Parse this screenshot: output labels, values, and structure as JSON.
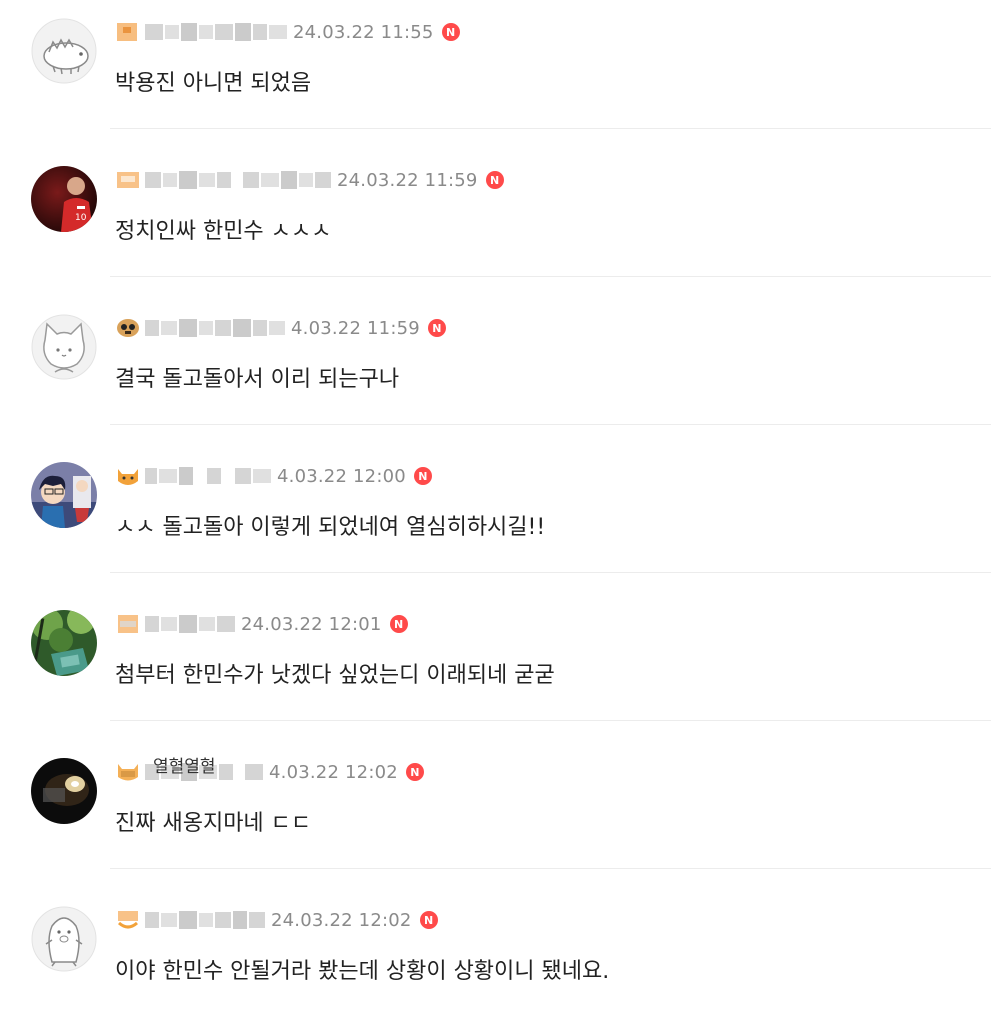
{
  "comments": [
    {
      "timestamp": "24.03.22 11:55",
      "text": "박용진 아니면 되었음",
      "badge": "N",
      "avatar": "dragon-avatar",
      "level_icon": "orange-square-icon"
    },
    {
      "timestamp": "24.03.22 11:59",
      "text": "정치인싸 한민수 ㅅㅅㅅ",
      "badge": "N",
      "avatar": "soccer-player-avatar",
      "level_icon": "orange-square-icon"
    },
    {
      "timestamp": "4.03.22 11:59",
      "text": "결국 돌고돌아서 이리 되는구나",
      "badge": "N",
      "avatar": "cat-avatar",
      "level_icon": "face-icon"
    },
    {
      "timestamp": "4.03.22 12:00",
      "text": "ㅅㅅ 돌고돌아 이렇게 되었네여 열심히하시길!!",
      "badge": "N",
      "avatar": "anime-avatar",
      "level_icon": "cat-face-icon"
    },
    {
      "timestamp": "24.03.22 12:01",
      "text": "첨부터 한민수가 낫겠다 싶었는디 이래되네 굳굳",
      "badge": "N",
      "avatar": "green-photo-avatar",
      "level_icon": "orange-square-icon"
    },
    {
      "timestamp": "4.03.22 12:02",
      "text": "진짜 새옹지마네 ㄷㄷ",
      "badge": "N",
      "avatar": "dark-photo-avatar",
      "level_icon": "cat-face-icon",
      "partial_name": "열혈열혈"
    },
    {
      "timestamp": "24.03.22 12:02",
      "text": "이야 한민수 안될거라 봤는데 상황이 상황이니 됐네요.",
      "badge": "N",
      "avatar": "penguin-avatar",
      "level_icon": "orange-smile-icon"
    }
  ]
}
